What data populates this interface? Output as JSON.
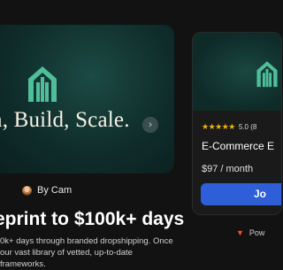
{
  "hero": {
    "tagline": "n, Build, Scale.",
    "next_icon": "chevron-right-icon",
    "carousel_slide_count": 8,
    "active_slide_index": 0
  },
  "author": {
    "name": "By Cam"
  },
  "product": {
    "headline": "eprint to $100k+ days",
    "description_lines": [
      "0k+ days through branded dropshipping. Once",
      "our vast library of vetted, up-to-date",
      "frameworks."
    ]
  },
  "card": {
    "stars": "★★★★★",
    "rating_text": "5.0 (8",
    "title": "E-Commerce E",
    "price": "$97 / month",
    "cta": "Jo"
  },
  "footer": {
    "powered_by": "Pow"
  },
  "colors": {
    "accent": "#2f5fd8",
    "star": "#f5b400",
    "logo": "#4fbf9a"
  }
}
